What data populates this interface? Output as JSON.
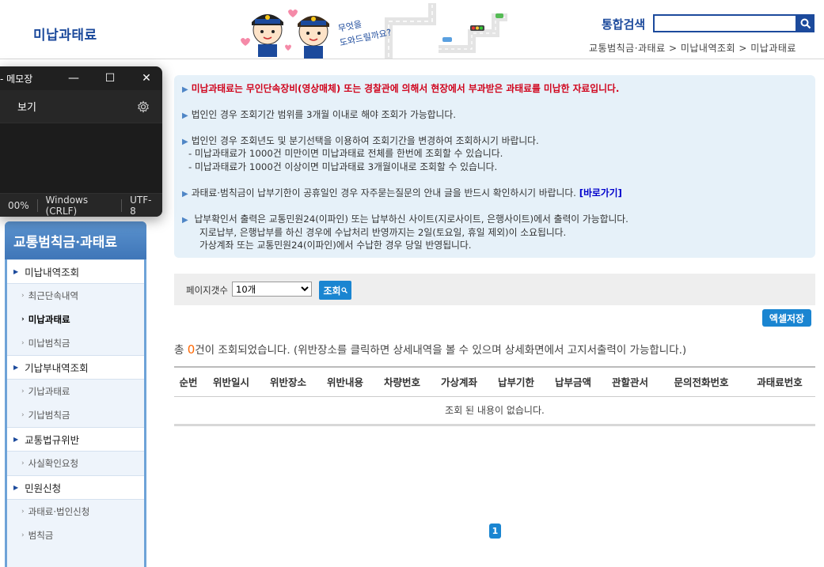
{
  "header": {
    "title": "미납과태료",
    "search_label": "통합검색",
    "search_value": "",
    "breadcrumb": "교통범칙금·과태료 > 미납내역조회 > 미납과태료",
    "mascot_caption": "무엇을 도와드릴까요?",
    "accent_color": "#1c4a9c"
  },
  "notepad": {
    "title": "- 메모장",
    "minimize": "—",
    "maximize": "☐",
    "close": "✕",
    "menu_view": "보기",
    "status_zoom": "00%",
    "status_eol": "Windows (CRLF)",
    "status_encoding": "UTF-8"
  },
  "sidebar": {
    "title": "교통범칙금·과태료",
    "groups": [
      {
        "label": "미납내역조회",
        "items": [
          "최근단속내역",
          "미납과태료",
          "미납범칙금"
        ]
      },
      {
        "label": "기납부내역조회",
        "items": [
          "기납과태료",
          "기납범칙금"
        ]
      },
      {
        "label": "교통법규위반",
        "items": [
          "사실확인요청"
        ]
      },
      {
        "label": "민원신청",
        "items": [
          "과태료·법인신청",
          "범칙금"
        ]
      }
    ]
  },
  "notice": {
    "line1": "미납과태료는 무인단속장비(영상매체) 또는 경찰관에 의해서 현장에서 부과받은 과태료를 미납한 자료입니다.",
    "line2": "법인인 경우 조회기간 범위를 3개월 이내로 해야 조회가 가능합니다.",
    "line3": "법인인 경우 조회년도 및 분기선택을 이용하여 조회기간을 변경하여 조회하시기 바랍니다.",
    "line3a": "- 미납과태료가 1000건 미만이면 미납과태료 전체를 한번에 조회할 수 있습니다.",
    "line3b": "- 미납과태료가 1000건 이상이면 미납과태료 3개월이내로 조회할 수 있습니다.",
    "line4": "과태료·범칙금이 납부기한이 공휴일인 경우 자주묻는질문의 안내 글을 반드시 확인하시기 바랍니다.",
    "line4_link": "[바로가기]",
    "line5": "납부확인서 출력은 교통민원24(이파인) 또는 납부하신 사이트(지로사이트, 은행사이트)에서 출력이 가능합니다.",
    "line5a": "지로납부, 은행납부를 하신 경우에 수납처리 반영까지는 2일(토요일, 휴일 제외)이 소요됩니다.",
    "line5b": "가상계좌 또는 교통민원24(이파인)에서 수납한 경우 당일 반영됩니다."
  },
  "filter": {
    "label": "페이지갯수",
    "selected": "10개",
    "search_button": "조회"
  },
  "excel_button": "엑셀저장",
  "result": {
    "prefix": "총 ",
    "count": "0",
    "suffix": "건이 조회되었습니다. (위반장소를 클릭하면 상세내역을 볼 수 있으며 상세화면에서 고지서출력이 가능합니다.)"
  },
  "table": {
    "columns": [
      "순번",
      "위반일시",
      "위반장소",
      "위반내용",
      "차량번호",
      "가상계좌",
      "납부기한",
      "납부금액",
      "관할관서",
      "문의전화번호",
      "과태료번호"
    ],
    "empty_message": "조회 된 내용이 없습니다."
  },
  "pagination": {
    "current": "1"
  }
}
